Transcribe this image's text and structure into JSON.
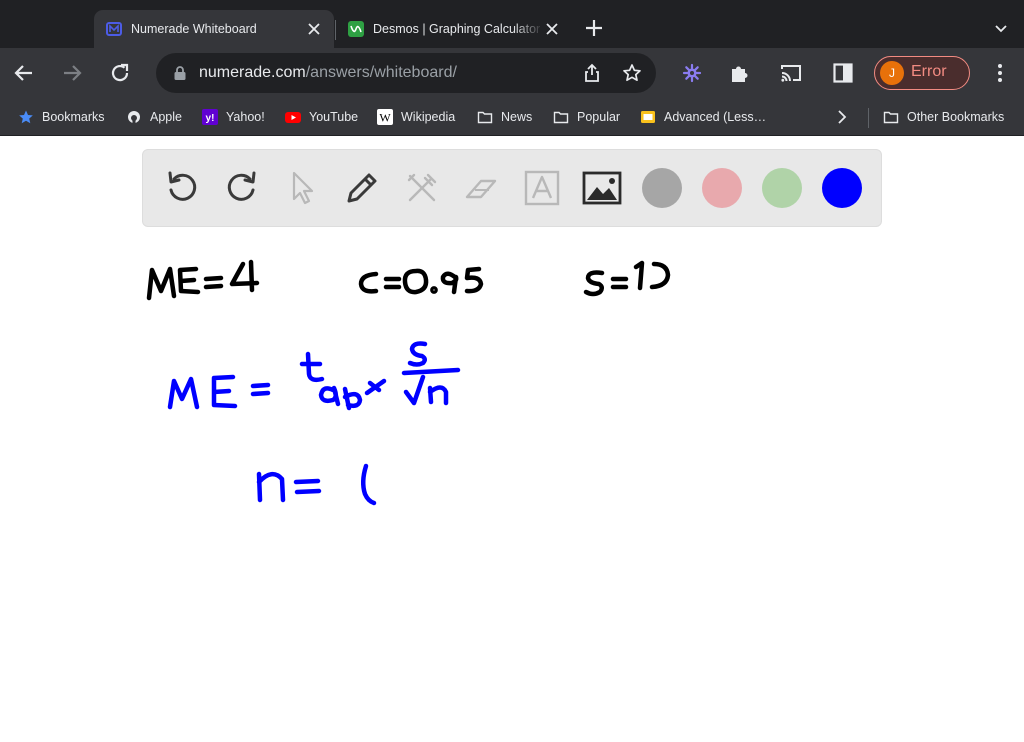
{
  "browser": {
    "tabs": [
      {
        "title": "Numerade Whiteboard",
        "active": true
      },
      {
        "title": "Desmos | Graphing Calculator",
        "active": false
      }
    ],
    "address": {
      "host": "numerade.com",
      "path": "/answers/whiteboard/"
    },
    "profile": {
      "initial": "J",
      "label": "Error"
    },
    "bookmarks": [
      {
        "label": "Bookmarks",
        "icon": "star-icon"
      },
      {
        "label": "Apple",
        "icon": "apple-icon"
      },
      {
        "label": "Yahoo!",
        "icon": "yahoo-icon"
      },
      {
        "label": "YouTube",
        "icon": "youtube-icon"
      },
      {
        "label": "Wikipedia",
        "icon": "wikipedia-icon"
      },
      {
        "label": "News",
        "icon": "folder-icon"
      },
      {
        "label": "Popular",
        "icon": "folder-icon"
      },
      {
        "label": "Advanced (Less…",
        "icon": "bookmark-page-icon"
      }
    ],
    "other_bookmarks": "Other Bookmarks"
  },
  "whiteboard": {
    "tools": [
      "undo-icon",
      "redo-icon",
      "select-pointer-icon",
      "pen-icon",
      "shapes-tools-icon",
      "eraser-icon",
      "text-icon",
      "image-icon"
    ],
    "colors": [
      "#a6a6a6",
      "#e8a9ad",
      "#b0d3a8",
      "#0000ff"
    ],
    "ink_colors": {
      "black": "#000000",
      "blue": "#0000ff"
    }
  }
}
